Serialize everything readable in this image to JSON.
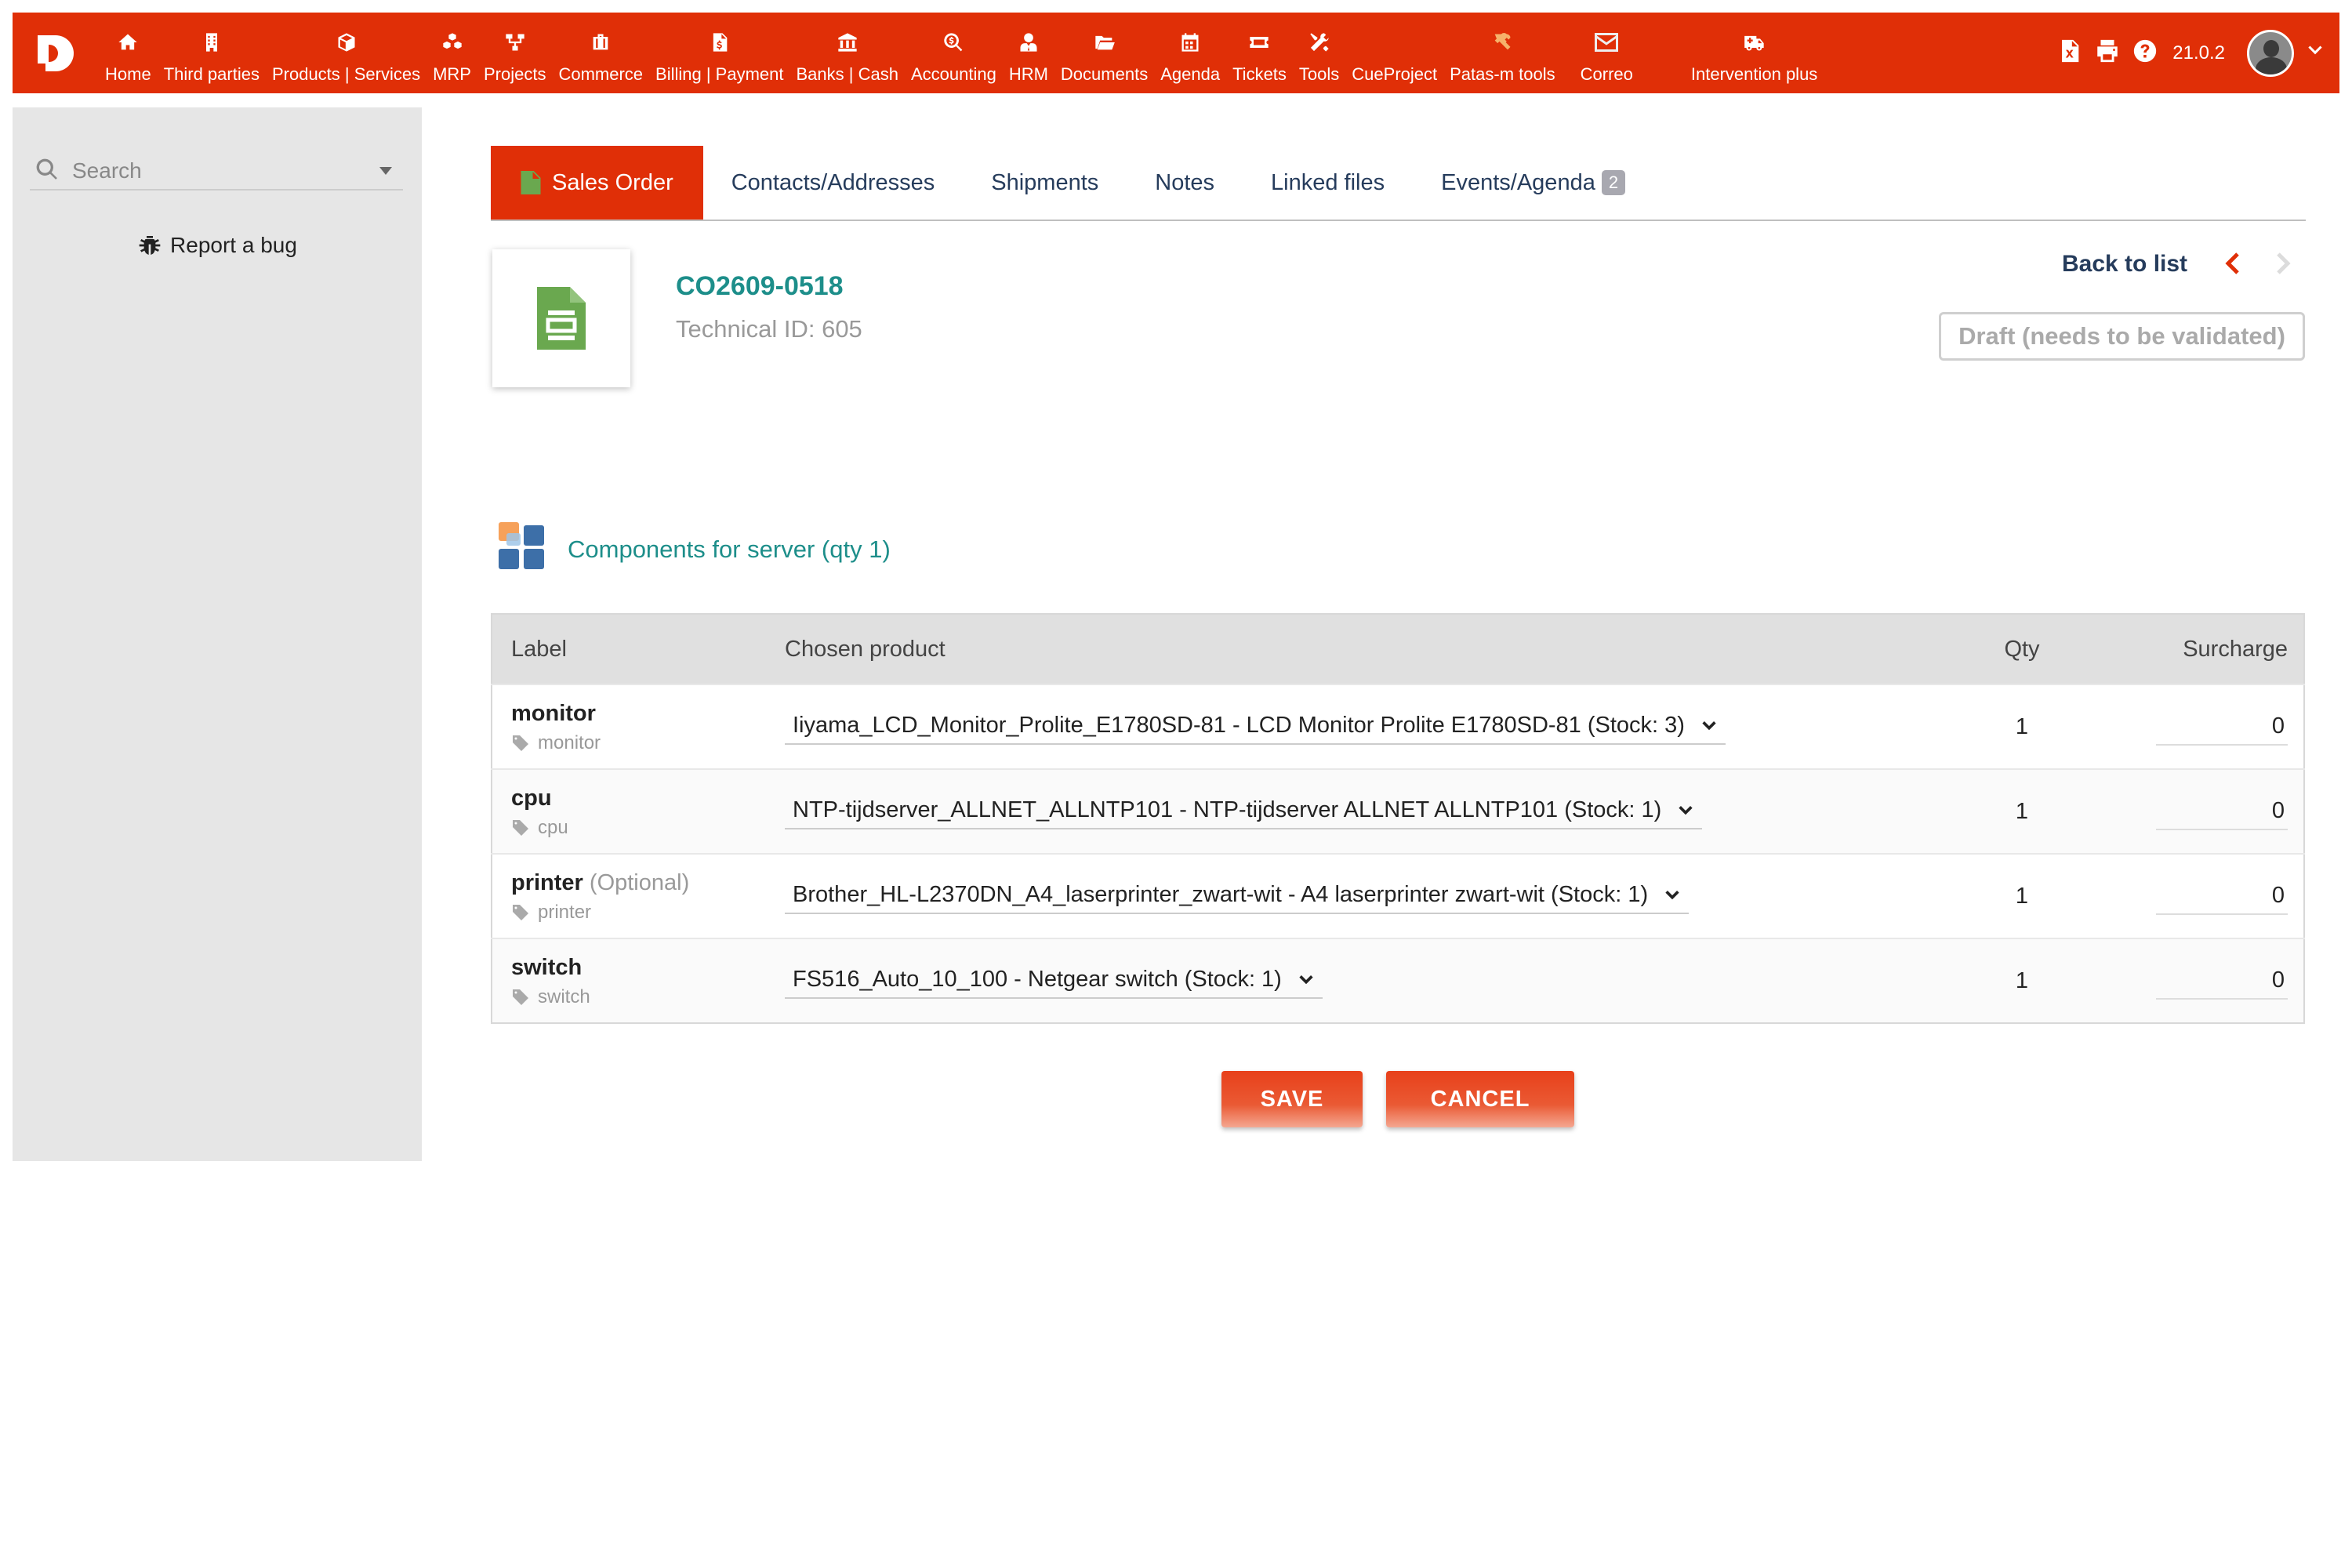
{
  "topbar": {
    "menu": [
      {
        "label": "Home",
        "icon": "home-icon"
      },
      {
        "label": "Third parties",
        "icon": "building-icon"
      },
      {
        "label": "Products | Services",
        "icon": "cube-icon"
      },
      {
        "label": "MRP",
        "icon": "cubes-icon"
      },
      {
        "label": "Projects",
        "icon": "sitemap-icon"
      },
      {
        "label": "Commerce",
        "icon": "suitcase-icon"
      },
      {
        "label": "Billing | Payment",
        "icon": "invoice-icon"
      },
      {
        "label": "Banks | Cash",
        "icon": "bank-icon"
      },
      {
        "label": "Accounting",
        "icon": "search-dollar-icon"
      },
      {
        "label": "HRM",
        "icon": "user-tie-icon"
      },
      {
        "label": "Documents",
        "icon": "folder-open-icon"
      },
      {
        "label": "Agenda",
        "icon": "calendar-icon"
      },
      {
        "label": "Tickets",
        "icon": "ticket-icon"
      },
      {
        "label": "Tools",
        "icon": "tools-icon"
      },
      {
        "label": "CueProject",
        "icon": "none"
      },
      {
        "label": "Patas-m tools",
        "icon": "hammer-wrench-icon"
      },
      {
        "label": "Correo",
        "icon": "envelope-icon"
      },
      {
        "label": "Intervention plus",
        "icon": "ambulance-icon"
      }
    ],
    "version": "21.0.2"
  },
  "sidebar": {
    "search_placeholder": "Search",
    "report_bug": "Report a bug"
  },
  "tabs": [
    {
      "label": "Sales Order",
      "active": true
    },
    {
      "label": "Contacts/Addresses"
    },
    {
      "label": "Shipments"
    },
    {
      "label": "Notes"
    },
    {
      "label": "Linked files"
    },
    {
      "label": "Events/Agenda",
      "badge": "2"
    }
  ],
  "order": {
    "ref": "CO2609-0518",
    "technical_id": "Technical ID: 605",
    "back_to_list": "Back to list",
    "status": "Draft (needs to be validated)"
  },
  "components": {
    "title": "Components for server (qty 1)",
    "columns": {
      "label": "Label",
      "product": "Chosen product",
      "qty": "Qty",
      "surcharge": "Surcharge"
    },
    "rows": [
      {
        "label": "monitor",
        "optional": "",
        "tag": "monitor",
        "product": "Iiyama_LCD_Monitor_Prolite_E1780SD-81 - LCD Monitor Prolite E1780SD-81 (Stock: 3)",
        "qty": "1",
        "surcharge": "0"
      },
      {
        "label": "cpu",
        "optional": "",
        "tag": "cpu",
        "product": "NTP-tijdserver_ALLNET_ALLNTP101 - NTP-tijdserver ALLNET ALLNTP101 (Stock: 1)",
        "qty": "1",
        "surcharge": "0"
      },
      {
        "label": "printer",
        "optional": "(Optional)",
        "tag": "printer",
        "product": "Brother_HL-L2370DN_A4_laserprinter_zwart-wit - A4 laserprinter zwart-wit (Stock: 1)",
        "qty": "1",
        "surcharge": "0"
      },
      {
        "label": "switch",
        "optional": "",
        "tag": "switch",
        "product": "FS516_Auto_10_100 - Netgear switch (Stock: 1)",
        "qty": "1",
        "surcharge": "0"
      }
    ]
  },
  "actions": {
    "save": "SAVE",
    "cancel": "CANCEL"
  },
  "colors": {
    "brand": "#e02f07",
    "accent_teal": "#1d8e8a",
    "nav_text": "#263c5c"
  }
}
